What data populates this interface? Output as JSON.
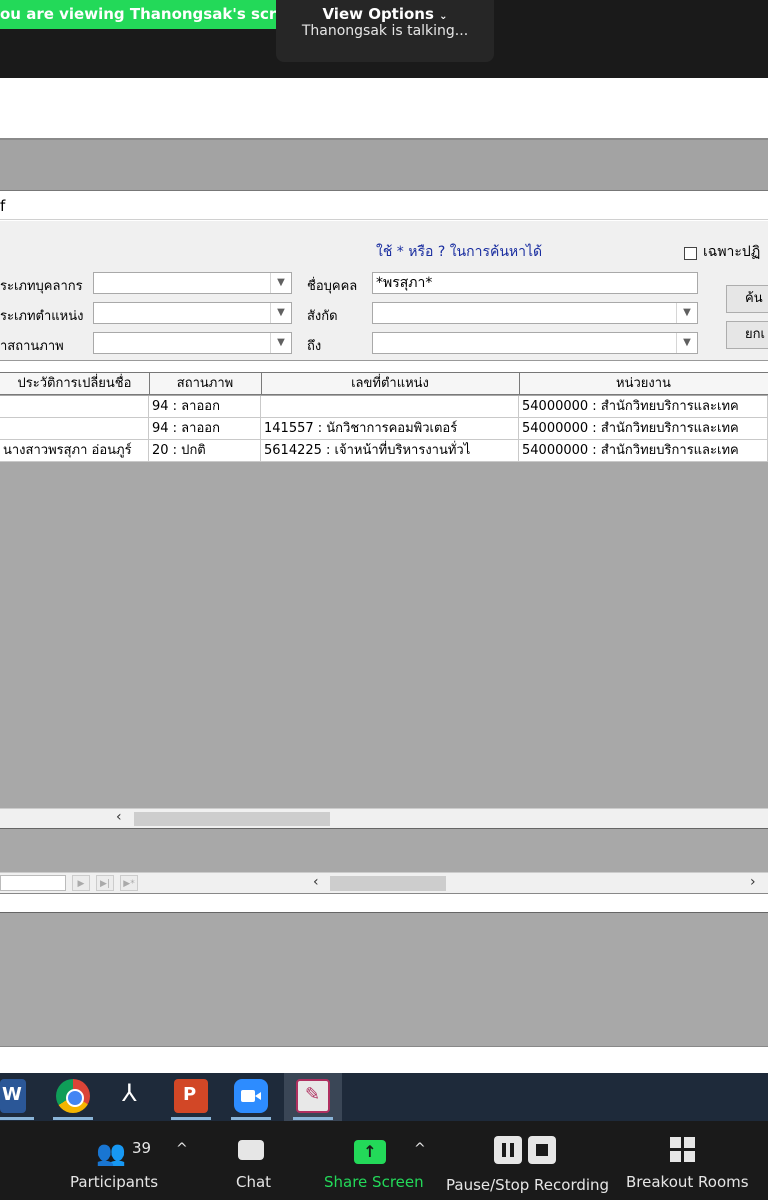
{
  "zoom_banner": {
    "viewing_text": "ou are viewing Thanongsak's screen",
    "view_options_label": "View Options",
    "talking_text": "Thanongsak is talking..."
  },
  "app": {
    "window_title": "f",
    "hint_text": "ใช้  * หรือ ? ในการค้นหาได้",
    "only_checkbox_label": "เฉพาะปฏิ",
    "labels": {
      "personnel_type": "ระเภทบุคลากร",
      "position_type": "ระเภทตำแหน่ง",
      "status": "าสถานภาพ",
      "person_name": "ชื่อบุคคล",
      "affiliation": "สังกัด",
      "to": "ถึง"
    },
    "fields": {
      "person_name_value": "*พรสุภา*"
    },
    "buttons": {
      "search": "ค้น",
      "cancel": "ยกเ"
    }
  },
  "grid": {
    "columns": [
      "ประวัติการเปลี่ยนชื่อ",
      "สถานภาพ",
      "เลขที่ตำแหน่ง",
      "หน่วยงาน"
    ],
    "rows": [
      [
        "",
        "94 : ลาออก",
        "",
        "54000000 : สำนักวิทยบริการและเทค"
      ],
      [
        "",
        "94 : ลาออก",
        "141557 : นักวิชาการคอมพิวเตอร์",
        "54000000 : สำนักวิทยบริการและเทค"
      ],
      [
        "นางสาวพรสุภา อ่อนภูร์",
        "20 : ปกติ",
        "5614225 : เจ้าหน้าที่บริหารงานทั่วไ",
        "54000000 : สำนักวิทยบริการและเทค"
      ]
    ]
  },
  "taskbar": {
    "apps": [
      "word-icon",
      "chrome-icon",
      "acrobat-icon",
      "powerpoint-icon",
      "zoom-icon",
      "paint-icon"
    ]
  },
  "zoom_controls": {
    "participants_label": "Participants",
    "participants_count": "39",
    "chat_label": "Chat",
    "share_label": "Share Screen",
    "record_label": "Pause/Stop Recording",
    "breakout_label": "Breakout Rooms"
  },
  "colors": {
    "banner_green": "#23d959",
    "share_green": "#23d959"
  }
}
